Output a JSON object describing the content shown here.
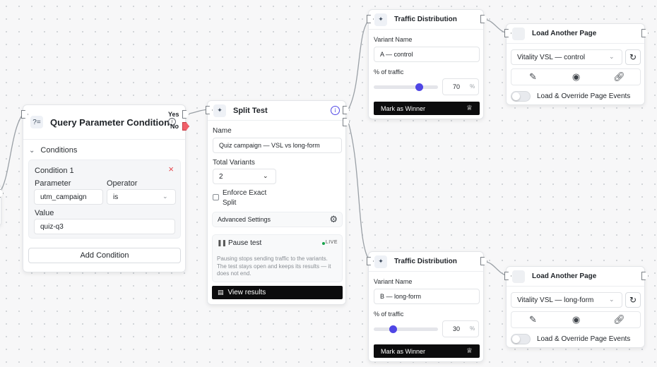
{
  "query_node": {
    "title": "Query Parameter Condition",
    "icon_glyph": "?=",
    "yes_label": "Yes",
    "no_label": "No",
    "conditions_header": "Conditions",
    "condition_title": "Condition 1",
    "parameter_label": "Parameter",
    "parameter_value": "utm_campaign",
    "operator_label": "Operator",
    "operator_value": "is",
    "value_label": "Value",
    "value_value": "quiz-q3",
    "add_condition_label": "Add Condition"
  },
  "split_node": {
    "title": "Split Test",
    "name_label": "Name",
    "name_value": "Quiz campaign — VSL vs long-form",
    "variants_label": "Total Variants",
    "variants_value": "2",
    "enforce_label_1": "Enforce Exact",
    "enforce_label_2": "Split",
    "advanced_label": "Advanced Settings",
    "pause_label": "Pause test",
    "live_label": "LIVE",
    "pause_description": "Pausing stops sending traffic to the variants. The test stays open and keeps its results — it does not end.",
    "view_results_label": "View results"
  },
  "traffic_nodes": [
    {
      "title": "Traffic Distribution",
      "variant_label": "Variant Name",
      "variant_value": "A — control",
      "traffic_label": "% of traffic",
      "traffic_value": "70",
      "traffic_fraction": 0.7,
      "percent_sign": "%",
      "mark_winner_label": "Mark as Winner"
    },
    {
      "title": "Traffic Distribution",
      "variant_label": "Variant Name",
      "variant_value": "B — long-form",
      "traffic_label": "% of traffic",
      "traffic_value": "30",
      "traffic_fraction": 0.3,
      "percent_sign": "%",
      "mark_winner_label": "Mark as Winner"
    }
  ],
  "page_nodes": [
    {
      "title": "Load Another Page",
      "page_value": "Vitality VSL — control",
      "override_label": "Load & Override Page Events"
    },
    {
      "title": "Load Another Page",
      "page_value": "Vitality VSL — long-form",
      "override_label": "Load & Override Page Events"
    }
  ],
  "colors": {
    "accent": "#4f46e5",
    "live": "#16a34a",
    "no_handle": "#f0606a",
    "delete": "#e5484d"
  }
}
